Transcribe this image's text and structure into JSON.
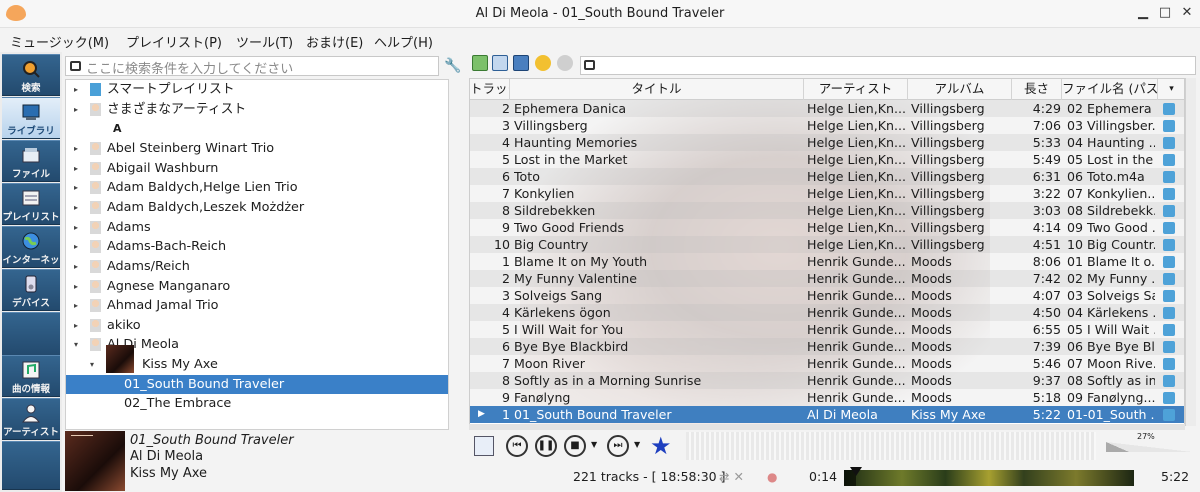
{
  "window": {
    "title": "Al Di Meola - 01_South Bound Traveler",
    "min": "▁",
    "max": "□",
    "close": "✕"
  },
  "menu": [
    "ミュージック(M)",
    "プレイリスト(P)",
    "ツール(T)",
    "おまけ(E)",
    "ヘルプ(H)"
  ],
  "sidebar": [
    {
      "label": "検索",
      "icon": "search-icon"
    },
    {
      "label": "ライブラリ",
      "icon": "library-icon",
      "active": true
    },
    {
      "label": "ファイル",
      "icon": "file-icon"
    },
    {
      "label": "プレイリスト",
      "icon": "playlist-icon"
    },
    {
      "label": "インターネット",
      "icon": "internet-icon"
    },
    {
      "label": "デバイス",
      "icon": "device-icon"
    },
    {
      "label": "曲の情報",
      "icon": "song-info-icon"
    },
    {
      "label": "アーティストの情",
      "icon": "artist-info-icon"
    }
  ],
  "library": {
    "search_placeholder": "ここに検索条件を入力してください",
    "tree": [
      {
        "label": "スマートプレイリスト",
        "kind": "smart",
        "arrow": "▸"
      },
      {
        "label": "さまざまなアーティスト",
        "kind": "artist",
        "arrow": "▸"
      },
      {
        "label": "A",
        "kind": "header",
        "arrow": ""
      },
      {
        "label": "Abel Steinberg Winart Trio",
        "kind": "artist",
        "arrow": "▸"
      },
      {
        "label": "Abigail Washburn",
        "kind": "artist",
        "arrow": "▸"
      },
      {
        "label": "Adam Baldych,Helge Lien Trio",
        "kind": "artist",
        "arrow": "▸"
      },
      {
        "label": "Adam Baldych,Leszek Możdżer",
        "kind": "artist",
        "arrow": "▸"
      },
      {
        "label": "Adams",
        "kind": "artist",
        "arrow": "▸"
      },
      {
        "label": "Adams-Bach-Reich",
        "kind": "artist",
        "arrow": "▸"
      },
      {
        "label": "Adams/Reich",
        "kind": "artist",
        "arrow": "▸"
      },
      {
        "label": "Agnese Manganaro",
        "kind": "artist",
        "arrow": "▸"
      },
      {
        "label": "Ahmad Jamal Trio",
        "kind": "artist",
        "arrow": "▸"
      },
      {
        "label": "akiko",
        "kind": "artist",
        "arrow": "▸"
      },
      {
        "label": "Al Di Meola",
        "kind": "artist",
        "arrow": "▾"
      },
      {
        "label": "Kiss My Axe",
        "kind": "album",
        "arrow": "▾"
      },
      {
        "label": "01_South Bound Traveler",
        "kind": "track",
        "arrow": "",
        "selected": true
      },
      {
        "label": "02_The Embrace",
        "kind": "track",
        "arrow": ""
      }
    ]
  },
  "now_playing": {
    "title": "01_South Bound Traveler",
    "artist": "Al Di Meola",
    "album": "Kiss My Axe"
  },
  "playlist": {
    "headers": {
      "track": "トラック",
      "title": "タイトル",
      "artist": "アーティスト",
      "album": "アルバム",
      "length": "長さ",
      "file": "ファイル名 (パスな"
    },
    "rows": [
      {
        "num": "2",
        "title": "Ephemera Danica",
        "artist": "Helge Lien,Kn...",
        "album": "Villingsberg",
        "len": "4:29",
        "file": "02 Ephemera ..."
      },
      {
        "num": "3",
        "title": "Villingsberg",
        "artist": "Helge Lien,Kn...",
        "album": "Villingsberg",
        "len": "7:06",
        "file": "03 Villingsber..."
      },
      {
        "num": "4",
        "title": "Haunting Memories",
        "artist": "Helge Lien,Kn...",
        "album": "Villingsberg",
        "len": "5:33",
        "file": "04 Haunting ..."
      },
      {
        "num": "5",
        "title": "Lost in the Market",
        "artist": "Helge Lien,Kn...",
        "album": "Villingsberg",
        "len": "5:49",
        "file": "05 Lost in the ..."
      },
      {
        "num": "6",
        "title": "Toto",
        "artist": "Helge Lien,Kn...",
        "album": "Villingsberg",
        "len": "6:31",
        "file": "06 Toto.m4a"
      },
      {
        "num": "7",
        "title": "Konkylien",
        "artist": "Helge Lien,Kn...",
        "album": "Villingsberg",
        "len": "3:22",
        "file": "07 Konkylien...."
      },
      {
        "num": "8",
        "title": "Sildrebekken",
        "artist": "Helge Lien,Kn...",
        "album": "Villingsberg",
        "len": "3:03",
        "file": "08 Sildrebekk..."
      },
      {
        "num": "9",
        "title": "Two Good Friends",
        "artist": "Helge Lien,Kn...",
        "album": "Villingsberg",
        "len": "4:14",
        "file": "09 Two Good ..."
      },
      {
        "num": "10",
        "title": "Big Country",
        "artist": "Helge Lien,Kn...",
        "album": "Villingsberg",
        "len": "4:51",
        "file": "10 Big Countr..."
      },
      {
        "num": "1",
        "title": "Blame It on My Youth",
        "artist": "Henrik Gunde...",
        "album": "Moods",
        "len": "8:06",
        "file": "01 Blame It o..."
      },
      {
        "num": "2",
        "title": "My Funny Valentine",
        "artist": "Henrik Gunde...",
        "album": "Moods",
        "len": "7:42",
        "file": "02 My Funny ..."
      },
      {
        "num": "3",
        "title": "Solveigs Sang",
        "artist": "Henrik Gunde...",
        "album": "Moods",
        "len": "4:07",
        "file": "03 Solveigs Sa..."
      },
      {
        "num": "4",
        "title": "Kärlekens ögon",
        "artist": "Henrik Gunde...",
        "album": "Moods",
        "len": "4:50",
        "file": "04 Kärlekens ..."
      },
      {
        "num": "5",
        "title": "I Will Wait for You",
        "artist": "Henrik Gunde...",
        "album": "Moods",
        "len": "6:55",
        "file": "05 I Will Wait ..."
      },
      {
        "num": "6",
        "title": "Bye Bye Blackbird",
        "artist": "Henrik Gunde...",
        "album": "Moods",
        "len": "7:39",
        "file": "06 Bye Bye Bl..."
      },
      {
        "num": "7",
        "title": "Moon River",
        "artist": "Henrik Gunde...",
        "album": "Moods",
        "len": "5:46",
        "file": "07 Moon Rive..."
      },
      {
        "num": "8",
        "title": "Softly as in a Morning Sunrise",
        "artist": "Henrik Gunde...",
        "album": "Moods",
        "len": "9:37",
        "file": "08 Softly as in..."
      },
      {
        "num": "9",
        "title": "Fanølyng",
        "artist": "Henrik Gunde...",
        "album": "Moods",
        "len": "5:18",
        "file": "09 Fanølyng...."
      },
      {
        "num": "1",
        "title": "01_South Bound Traveler",
        "artist": "Al Di Meola",
        "album": "Kiss My Axe",
        "len": "5:22",
        "file": "01-01_South ...",
        "playing": true
      }
    ]
  },
  "status": {
    "tracks": "221 tracks - [ 18:58:30 ]",
    "elapsed": "0:14",
    "total": "5:22",
    "volume": "27%",
    "progress_fraction": 0.043
  },
  "colors": {
    "accent": "#3a80c8",
    "sidebar": "#2f5f8a",
    "star": "#1e3fbf"
  }
}
